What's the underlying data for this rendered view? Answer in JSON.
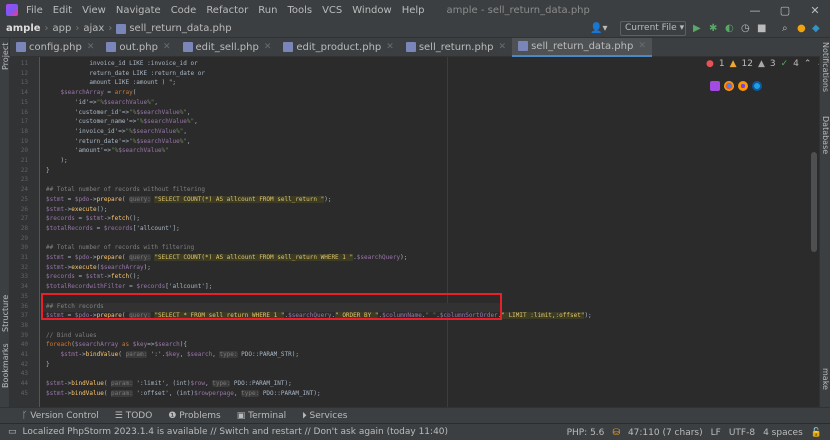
{
  "menu": [
    "File",
    "Edit",
    "View",
    "Navigate",
    "Code",
    "Refactor",
    "Run",
    "Tools",
    "VCS",
    "Window",
    "Help"
  ],
  "window_title": "ample - sell_return_data.php",
  "window_controls": {
    "minimize": "—",
    "maximize": "▢",
    "close": "✕"
  },
  "breadcrumbs": [
    "ample",
    "app",
    "ajax",
    "sell_return_data.php"
  ],
  "run_config": "Current File ▾",
  "tabs": [
    {
      "label": "config.php"
    },
    {
      "label": "out.php"
    },
    {
      "label": "edit_sell.php"
    },
    {
      "label": "edit_product.php"
    },
    {
      "label": "sell_return.php"
    },
    {
      "label": "sell_return_data.php"
    }
  ],
  "left_tool_labels": {
    "project": "Project",
    "structure": "Structure",
    "bookmarks": "Bookmarks"
  },
  "right_tool_labels": {
    "notifications": "Notifications",
    "database": "Database",
    "make": "make"
  },
  "problems": {
    "errors": "1",
    "warnings": "12",
    "weak": "3",
    "ok": "4"
  },
  "code_lines": [
    {
      "n": "11",
      "t": "            invoice_id LIKE :invoice_id or"
    },
    {
      "n": "12",
      "t": "            return_date LIKE :return_date or"
    },
    {
      "n": "13",
      "t": "            amount LIKE :amount ) \";"
    },
    {
      "n": "14",
      "t": "    $searchArray = array("
    },
    {
      "n": "15",
      "t": "        'id'=>\"%$searchValue%\","
    },
    {
      "n": "16",
      "t": "        'customer_id'=>\"%$searchValue%\","
    },
    {
      "n": "17",
      "t": "        'customer_name'=>\"%$searchValue%\","
    },
    {
      "n": "18",
      "t": "        'invoice_id'=>\"%$searchValue%\","
    },
    {
      "n": "19",
      "t": "        'return_date'=>\"%$searchValue%\","
    },
    {
      "n": "20",
      "t": "        'amount'=>\"%$searchValue%\""
    },
    {
      "n": "21",
      "t": "    );"
    },
    {
      "n": "22",
      "t": "}"
    },
    {
      "n": "23",
      "t": ""
    },
    {
      "n": "24",
      "t": "## Total number of records without filtering"
    },
    {
      "n": "25",
      "t": "$stmt = $pdo->prepare( query: \"SELECT COUNT(*) AS allcount FROM sell_return \");"
    },
    {
      "n": "26",
      "t": "$stmt->execute();"
    },
    {
      "n": "27",
      "t": "$records = $stmt->fetch();"
    },
    {
      "n": "28",
      "t": "$totalRecords = $records['allcount'];"
    },
    {
      "n": "29",
      "t": ""
    },
    {
      "n": "30",
      "t": "## Total number of records with filtering"
    },
    {
      "n": "31",
      "t": "$stmt = $pdo->prepare( query: \"SELECT COUNT(*) AS allcount FROM sell_return WHERE 1 \".$searchQuery);"
    },
    {
      "n": "32",
      "t": "$stmt->execute($searchArray);"
    },
    {
      "n": "33",
      "t": "$records = $stmt->fetch();"
    },
    {
      "n": "34",
      "t": "$totalRecordwithFilter = $records['allcount'];"
    },
    {
      "n": "35",
      "t": ""
    },
    {
      "n": "36",
      "t": "## Fetch records"
    },
    {
      "n": "37",
      "t": "$stmt = $pdo->prepare( query: \"SELECT * FROM sell_return WHERE 1 \".$searchQuery.\" ORDER BY \".$columnName.\" \".$columnSortOrder.\" LIMIT :limit,:offset\");"
    },
    {
      "n": "38",
      "t": ""
    },
    {
      "n": "39",
      "t": "// Bind values"
    },
    {
      "n": "40",
      "t": "foreach($searchArray as $key=>$search){"
    },
    {
      "n": "41",
      "t": "    $stmt->bindValue( param: ':'.$key, $search, type: PDO::PARAM_STR);"
    },
    {
      "n": "42",
      "t": "}"
    },
    {
      "n": "43",
      "t": ""
    },
    {
      "n": "44",
      "t": "$stmt->bindValue( param: ':limit', (int)$row, type: PDO::PARAM_INT);"
    },
    {
      "n": "45",
      "t": "$stmt->bindValue( param: ':offset', (int)$rowperpage, type: PDO::PARAM_INT);"
    }
  ],
  "tool_windows": [
    "Version Control",
    "TODO",
    "Problems",
    "Terminal",
    "Services"
  ],
  "status_message": "Localized PhpStorm 2023.1.4 is available // Switch and restart // Don't ask again (today 11:40)",
  "status_right": [
    "PHP: 5.6",
    "47:110 (7 chars)",
    "LF",
    "UTF-8",
    "4 spaces"
  ],
  "colors": {
    "highlight_box": "#e8202a",
    "accent": "#4a88c7"
  }
}
